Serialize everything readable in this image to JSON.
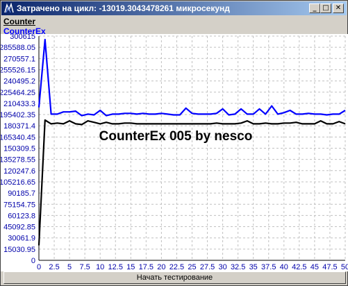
{
  "window": {
    "title": "Затрачено на цикл: -13019.3043478261 микросекунд",
    "minimize_glyph": "_",
    "maximize_glyph": "□",
    "close_glyph": "✕"
  },
  "menu": {
    "counter_label": "Counter",
    "counterex_label": "CounterEx"
  },
  "button": {
    "start_label": "Начать тестирование"
  },
  "colors": {
    "series_blue": "#0000ff",
    "series_black": "#000000",
    "axis_text_blue": "#0000aa",
    "grid": "#c0c0c0"
  },
  "chart_data": {
    "type": "line",
    "annotation": "CounterEx 005 by nesco",
    "y_ticks": [
      "300615",
      "285588.05",
      "270557.1",
      "255526.15",
      "240495.2",
      "225464.25",
      "210433.3",
      "195402.35",
      "180371.4",
      "165340.45",
      "150309.5",
      "135278.55",
      "120247.6",
      "105216.65",
      "90185.7",
      "75154.75",
      "60123.8",
      "45092.85",
      "30061.9",
      "15030.95",
      "0"
    ],
    "x_ticks": [
      "0",
      "2.5",
      "5",
      "7.5",
      "10",
      "12.5",
      "15",
      "17.5",
      "20",
      "22.5",
      "25",
      "27.5",
      "30",
      "32.5",
      "35",
      "37.5",
      "40",
      "42.5",
      "45",
      "47.5",
      "50"
    ],
    "xlim": [
      0,
      50
    ],
    "ylim": [
      0,
      300615
    ],
    "grid": true,
    "series": [
      {
        "color": "#0000ff",
        "x": [
          0,
          1,
          2,
          3,
          4,
          5,
          6,
          7,
          8,
          9,
          10,
          11,
          12,
          13,
          14,
          15,
          16,
          17,
          18,
          19,
          20,
          21,
          22,
          23,
          24,
          25,
          26,
          27,
          28,
          29,
          30,
          31,
          32,
          33,
          34,
          35,
          36,
          37,
          38,
          39,
          40,
          41,
          42,
          43,
          44,
          45,
          46,
          47,
          48,
          49,
          50
        ],
        "values": [
          205000,
          296000,
          196000,
          196000,
          199000,
          199000,
          200000,
          194000,
          196000,
          195000,
          201000,
          194000,
          196000,
          196000,
          197000,
          197000,
          196000,
          197000,
          196000,
          196000,
          197000,
          196000,
          195000,
          195000,
          204000,
          197000,
          196000,
          196000,
          196000,
          197000,
          203000,
          195000,
          196000,
          203000,
          196000,
          196000,
          203000,
          196000,
          207000,
          196000,
          198000,
          201000,
          196000,
          196000,
          197000,
          196000,
          196000,
          195000,
          196000,
          196000,
          201000
        ]
      },
      {
        "color": "#000000",
        "x": [
          0,
          1,
          2,
          3,
          4,
          5,
          6,
          7,
          8,
          9,
          10,
          11,
          12,
          13,
          14,
          15,
          16,
          17,
          18,
          19,
          20,
          21,
          22,
          23,
          24,
          25,
          26,
          27,
          28,
          29,
          30,
          31,
          32,
          33,
          34,
          35,
          36,
          37,
          38,
          39,
          40,
          41,
          42,
          43,
          44,
          45,
          46,
          47,
          48,
          49,
          50
        ],
        "values": [
          20000,
          188000,
          183000,
          184000,
          183000,
          187000,
          183000,
          182000,
          187000,
          185000,
          183000,
          185000,
          183000,
          183000,
          184000,
          184000,
          183000,
          183000,
          183000,
          183000,
          183000,
          183000,
          183000,
          183000,
          183000,
          183000,
          183000,
          183000,
          183000,
          184000,
          183000,
          183000,
          183000,
          184000,
          187000,
          183000,
          183000,
          184000,
          183000,
          183000,
          184000,
          184000,
          185000,
          183000,
          183000,
          183000,
          187000,
          183000,
          183000,
          186000,
          183000
        ]
      }
    ]
  }
}
